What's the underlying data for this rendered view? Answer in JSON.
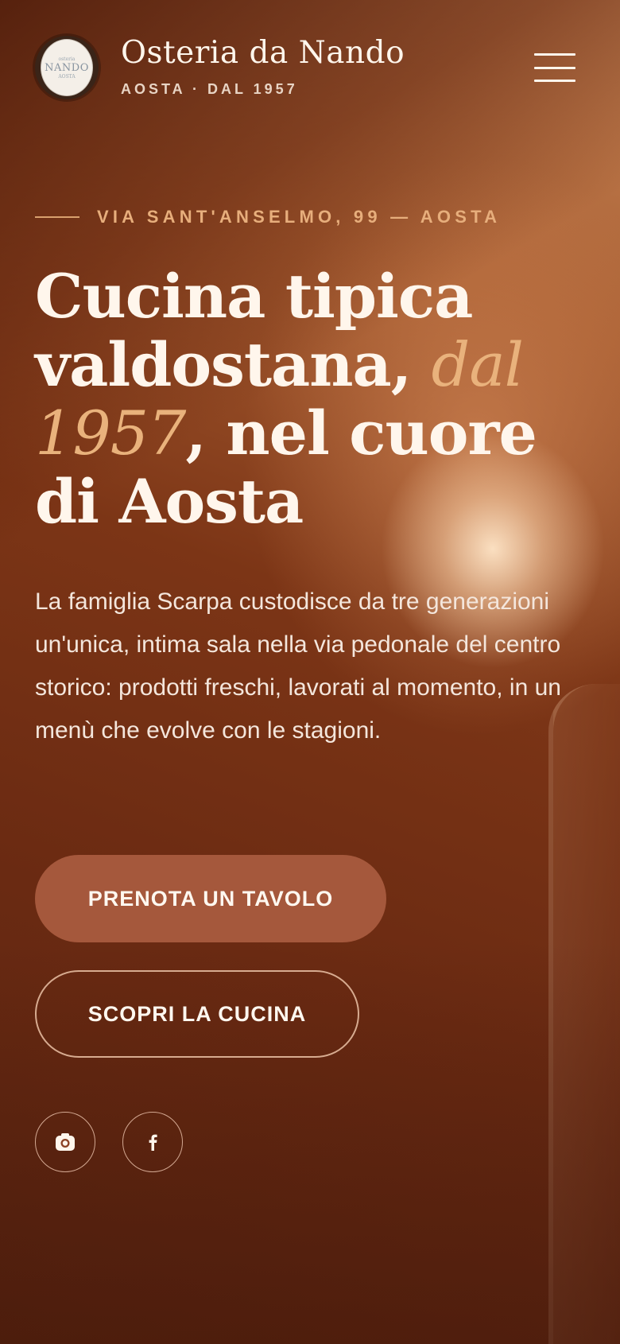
{
  "header": {
    "logo": {
      "line1": "osteria",
      "line2": "NANDO",
      "line3": "AOSTA"
    },
    "brand_name": "Osteria da Nando",
    "brand_sub": "AOSTA · DAL 1957",
    "menu_icon": "hamburger-menu-icon"
  },
  "hero": {
    "kicker": "VIA SANT'ANSELMO, 99 — AOSTA",
    "title_part1": "Cucina tipica valdostana, ",
    "title_accent": "dal 1957",
    "title_part2": ", nel cuore di Aosta",
    "lead": "La famiglia Scarpa custodisce da tre generazioni un'unica, intima sala nella via pedonale del centro storico: prodotti freschi, lavorati al momento, in un menù che evolve con le stagioni."
  },
  "actions": {
    "primary_label": "PRENOTA UN TAVOLO",
    "secondary_label": "SCOPRI LA CUCINA"
  },
  "socials": [
    {
      "icon": "instagram-icon"
    },
    {
      "icon": "facebook-icon"
    }
  ],
  "colors": {
    "accent": "#e9b27c",
    "primary_button": "#a5583c",
    "text": "#fff6ec"
  }
}
